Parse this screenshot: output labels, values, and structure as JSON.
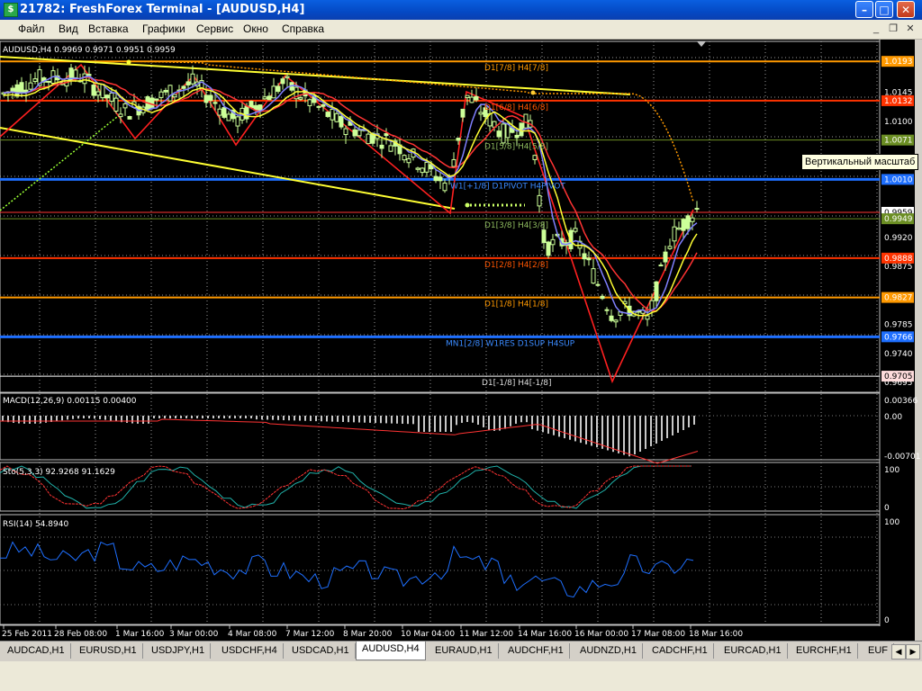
{
  "window": {
    "title": "21782: FreshForex Terminal - [AUDUSD,H4]",
    "app_icon": "terminal-app-icon",
    "buttons": [
      "minimize-icon",
      "maximize-icon",
      "close-icon"
    ]
  },
  "menu": {
    "items": [
      "Файл",
      "Вид",
      "Вставка",
      "Графики",
      "Сервис",
      "Окно",
      "Справка"
    ]
  },
  "chart": {
    "symbol_header": "AUDUSD,H4  0.9969 0.9971 0.9951 0.9959",
    "price_labels": [
      "1.0145",
      "1.0100",
      "0.9920",
      "0.9875",
      "0.9785",
      "0.9740",
      "0.9695"
    ],
    "level_badges": [
      {
        "text": "1.0193",
        "color": "#ff9900"
      },
      {
        "text": "1.0132",
        "color": "#ff3300"
      },
      {
        "text": "1.0071",
        "color": "#6b8e23"
      },
      {
        "text": "1.0010",
        "color": "#1e6fff"
      },
      {
        "text": "0.9959",
        "color": "#ffffff"
      },
      {
        "text": "0.9949",
        "color": "#6b8e23"
      },
      {
        "text": "0.9888",
        "color": "#ff3300"
      },
      {
        "text": "0.9827",
        "color": "#ff9900"
      },
      {
        "text": "0.9766",
        "color": "#1e6fff"
      },
      {
        "text": "0.9705",
        "color": "#ffdddd"
      }
    ],
    "level_texts": [
      "D1[7/8] H4[7/8]",
      "D1[6/8] H4[6/8]",
      "D1[5/8] H4[5/8]",
      "W1[+1/8] D1PIVOT H4PIVOT",
      "D1[3/8] H4[3/8]",
      "D1[2/8] H4[2/8]",
      "D1[1/8] H4[1/8]",
      "MN1[2/8] W1RES D1SUP H4SUP",
      "D1[-1/8] H4[-1/8]"
    ],
    "tooltip": "Вертикальный масштаб",
    "time_labels": [
      "25 Feb 2011",
      "28 Feb 08:00",
      "1 Mar 16:00",
      "3 Mar 00:00",
      "4 Mar 08:00",
      "7 Mar 12:00",
      "8 Mar 20:00",
      "10 Mar 04:00",
      "11 Mar 12:00",
      "14 Mar 16:00",
      "16 Mar 00:00",
      "17 Mar 08:00",
      "18 Mar 16:00"
    ]
  },
  "macd": {
    "label": "MACD(12,26,9) 0.00115 0.00400",
    "scale": [
      "0.00366",
      "0.00",
      "-0.00701"
    ]
  },
  "stoch": {
    "label": "Sto(5,3,3) 92.9268 91.1629",
    "scale": [
      "100",
      "0"
    ]
  },
  "rsi": {
    "label": "RSI(14) 54.8940",
    "scale": [
      "100",
      "0"
    ]
  },
  "tabs": [
    "AUDCAD,H1",
    "EURUSD,H1",
    "USDJPY,H1",
    "USDCHF,H4",
    "USDCAD,H1",
    "AUDUSD,H4",
    "EURAUD,H1",
    "AUDCHF,H1",
    "AUDNZD,H1",
    "CADCHF,H1",
    "EURCAD,H1",
    "EURCHF,H1",
    "EUF"
  ],
  "active_tab": "AUDUSD,H4",
  "colors": {
    "bull_candle": "#ccff99",
    "bear_candle": "#000000",
    "grid": "#cccccc",
    "ma_fast": "#ffff33",
    "ma_mid": "#8080ff",
    "ma_slow": "#ff3333"
  }
}
